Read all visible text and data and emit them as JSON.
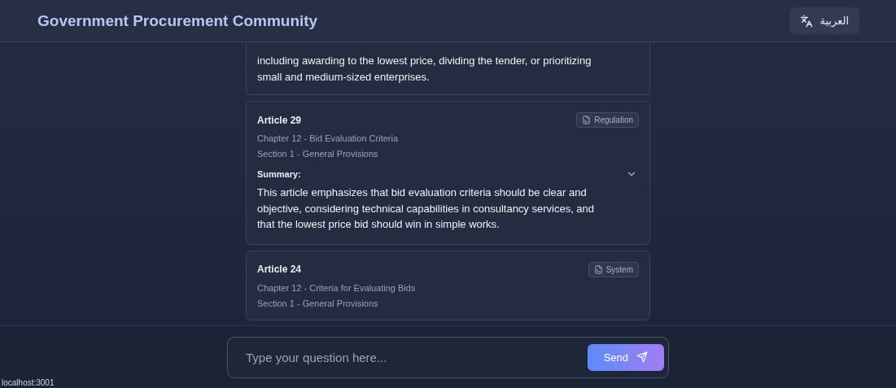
{
  "header": {
    "title": "Government Procurement Community",
    "language_button": {
      "label": "العربية"
    }
  },
  "articles": [
    {
      "summary": "including awarding to the lowest price, dividing the tender, or prioritizing small and medium-sized enterprises."
    },
    {
      "title": "Article 29",
      "badge": "Regulation",
      "chapter": "Chapter 12 - Bid Evaluation Criteria",
      "section": "Section 1 - General Provisions",
      "summary_label": "Summary:",
      "summary": "This article emphasizes that bid evaluation criteria should be clear and objective, considering technical capabilities in consultancy services, and that the lowest price bid should win in simple works."
    },
    {
      "title": "Article 24",
      "badge": "System",
      "chapter": "Chapter 12 - Criteria for Evaluating Bids",
      "section": "Section 1 - General Provisions"
    }
  ],
  "chat_input": {
    "placeholder": "Type your question here...",
    "send_button": "Send"
  },
  "status_bar": {
    "url": "localhost:3001"
  }
}
